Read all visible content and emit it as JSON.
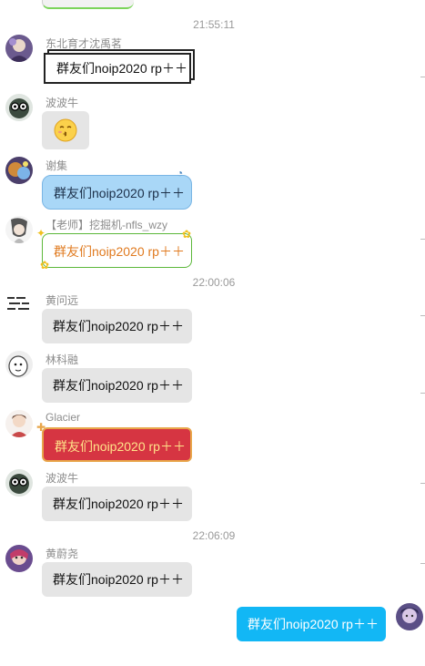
{
  "timestamps": [
    "21:55:11",
    "22:00:06",
    "22:06:09"
  ],
  "messages": [
    {
      "sender": "东北育才沈禹茗",
      "text": "群友们noip2020 rp＋＋",
      "style": "box"
    },
    {
      "sender": "波波牛",
      "emoji": "kiss-face-emoji",
      "style": "emoji"
    },
    {
      "sender": "谢集",
      "text": "群友们noip2020 rp＋＋",
      "style": "blue"
    },
    {
      "sender": "【老师】挖掘机-nfls_wzy",
      "text": "群友们noip2020 rp＋＋",
      "style": "green"
    },
    {
      "sender": "黄问远",
      "text": "群友们noip2020 rp＋＋",
      "style": "gray"
    },
    {
      "sender": "林科融",
      "text": "群友们noip2020 rp＋＋",
      "style": "gray"
    },
    {
      "sender": "Glacier",
      "text": "群友们noip2020 rp＋＋",
      "style": "red"
    },
    {
      "sender": "波波牛",
      "text": "群友们noip2020 rp＋＋",
      "style": "gray"
    },
    {
      "sender": "黄蔚尧",
      "text": "群友们noip2020 rp＋＋",
      "style": "gray"
    },
    {
      "sender": "",
      "text": "群友们noip2020 rp＋＋",
      "style": "self"
    }
  ],
  "colors": {
    "self_bubble": "#12b7f5",
    "gray_bubble": "#e5e5e5",
    "blue_bubble": "#a9d7f7",
    "red_bubble": "#d63542",
    "green_border": "#5cb83a",
    "timestamp": "#9a9a9a"
  }
}
